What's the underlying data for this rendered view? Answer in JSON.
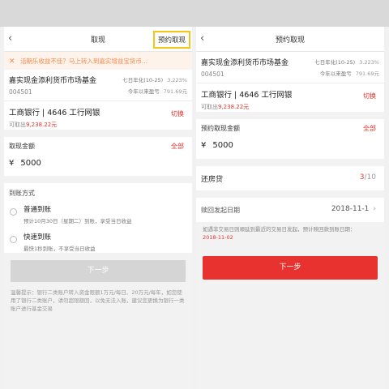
{
  "left": {
    "nav": {
      "back": "‹",
      "title": "取现",
      "reserve_link": "预约取现"
    },
    "notice": {
      "close": "✕",
      "text": "活期乐收益不佳？马上转入到嘉实增益宝货币..."
    },
    "fund": {
      "name": "嘉实现金添利货币市场基金",
      "code": "004501",
      "yield_label": "七日年化(10-25)",
      "yield_value": "3.223%",
      "profit_label": "今年以来盈亏",
      "profit_value": "791.69元"
    },
    "bank": {
      "name": "工商银行 | 4646 工行网银",
      "available_label": "可取出",
      "available_amount": "9,238.22元",
      "switch": "切换"
    },
    "amount": {
      "label": "取现金额",
      "all": "全部",
      "currency": "¥",
      "value": "5000"
    },
    "arrival": {
      "label": "到账方式",
      "options": [
        {
          "title": "普通到账",
          "desc": "预计10月30日（星期二）到账，享受当日收益"
        },
        {
          "title": "快速到账",
          "desc": "最快1秒到账，不享受当日收益"
        }
      ]
    },
    "next_button": "下一步",
    "tip": "温馨提示：银行二类账户转入资金限额1万元/每日、20万元/每年，如您使用了银行二类账户，请勿超限额回，以免无法入账，建议您更换为银行一类账户进行基金交易"
  },
  "right": {
    "nav": {
      "back": "‹",
      "title": "预约取现"
    },
    "fund": {
      "name": "嘉实现金添利货币市场基金",
      "code": "004501",
      "yield_label": "七日年化(10-25)",
      "yield_value": "3.223%",
      "profit_label": "今年以来盈亏",
      "profit_value": "791.69元"
    },
    "bank": {
      "name": "工商银行 | 4646 工行网银",
      "available_label": "可取出",
      "available_amount": "9,238.22元",
      "switch": "切换"
    },
    "amount": {
      "label": "预约取现金额",
      "all": "全部",
      "currency": "¥",
      "value": "5000"
    },
    "loan": {
      "title": "还房贷",
      "current": "3",
      "total": "/10"
    },
    "date": {
      "label": "赎回发起日期",
      "value": "2018-11-1",
      "chevron": "›"
    },
    "tip_text": "如遇非交易日则顺延到最近的交易日发起，预计赎回款到账日期：",
    "tip_date": "2018-11-02",
    "next_button": "下一步"
  },
  "colors": {
    "accent": "#e8322f",
    "highlight_box": "#f5c518",
    "notice_text": "#f08a4b"
  }
}
